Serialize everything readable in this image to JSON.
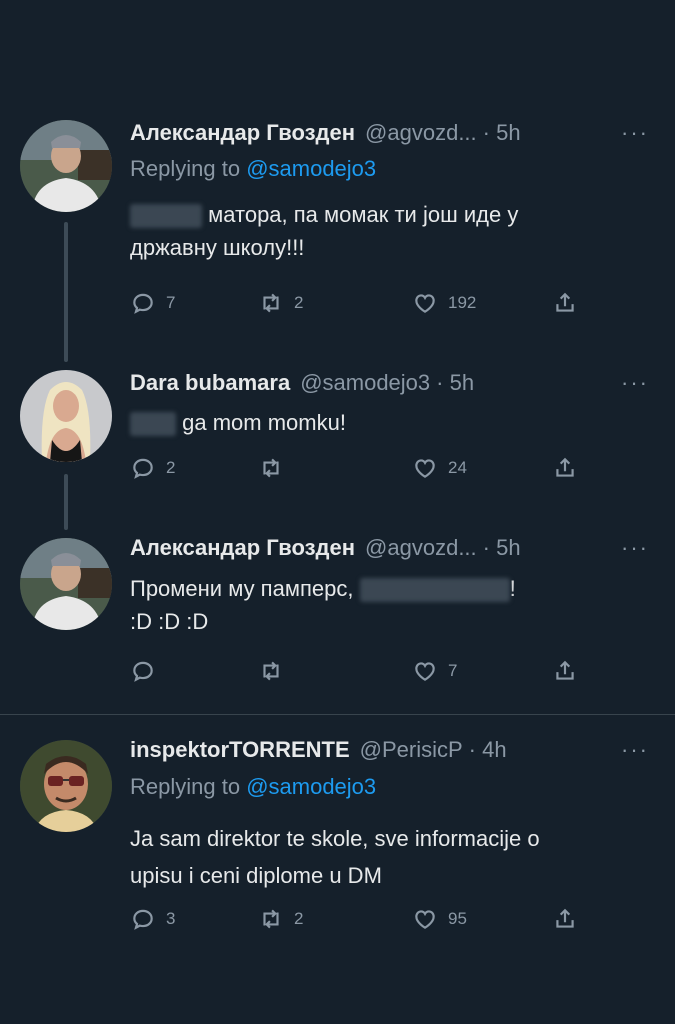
{
  "tweets": [
    {
      "name": "Александар Гвозден",
      "handle": "@agvozd...",
      "time": "· 5h",
      "replying_prefix": "Replying to ",
      "replying_mention": "@samodejo3",
      "line1_after_blur": "матора, па момак ти још иде у",
      "line2": "државну школу!!!",
      "reply_count": "7",
      "retweet_count": "2",
      "like_count": "192"
    },
    {
      "name": "Dara bubamara",
      "handle": "@samodejo3",
      "time": "· 5h",
      "line1_after_blur": "ga mom momku!",
      "reply_count": "2",
      "retweet_count": "",
      "like_count": "24"
    },
    {
      "name": "Александар Гвозден",
      "handle": "@agvozd...",
      "time": "· 5h",
      "line1_before_blur": "Промени му памперс,",
      "line1_after_blur": "!",
      "line2": ":D :D :D",
      "reply_count": "",
      "retweet_count": "",
      "like_count": "7"
    },
    {
      "name": "inspektorTORRENTE",
      "handle": "@PerisicP",
      "time": "· 4h",
      "replying_prefix": "Replying to ",
      "replying_mention": "@samodejo3",
      "line1": "Ja sam direktor te skole, sve informacije o",
      "line2": "upisu i ceni diplome u DM",
      "reply_count": "3",
      "retweet_count": "2",
      "like_count": "95"
    }
  ],
  "more_glyph": "···",
  "icons": [
    "reply-icon",
    "retweet-icon",
    "like-icon",
    "share-icon"
  ],
  "colors": {
    "background": "#15202b",
    "mention": "#1d9bf0",
    "muted": "#8b98a5"
  }
}
